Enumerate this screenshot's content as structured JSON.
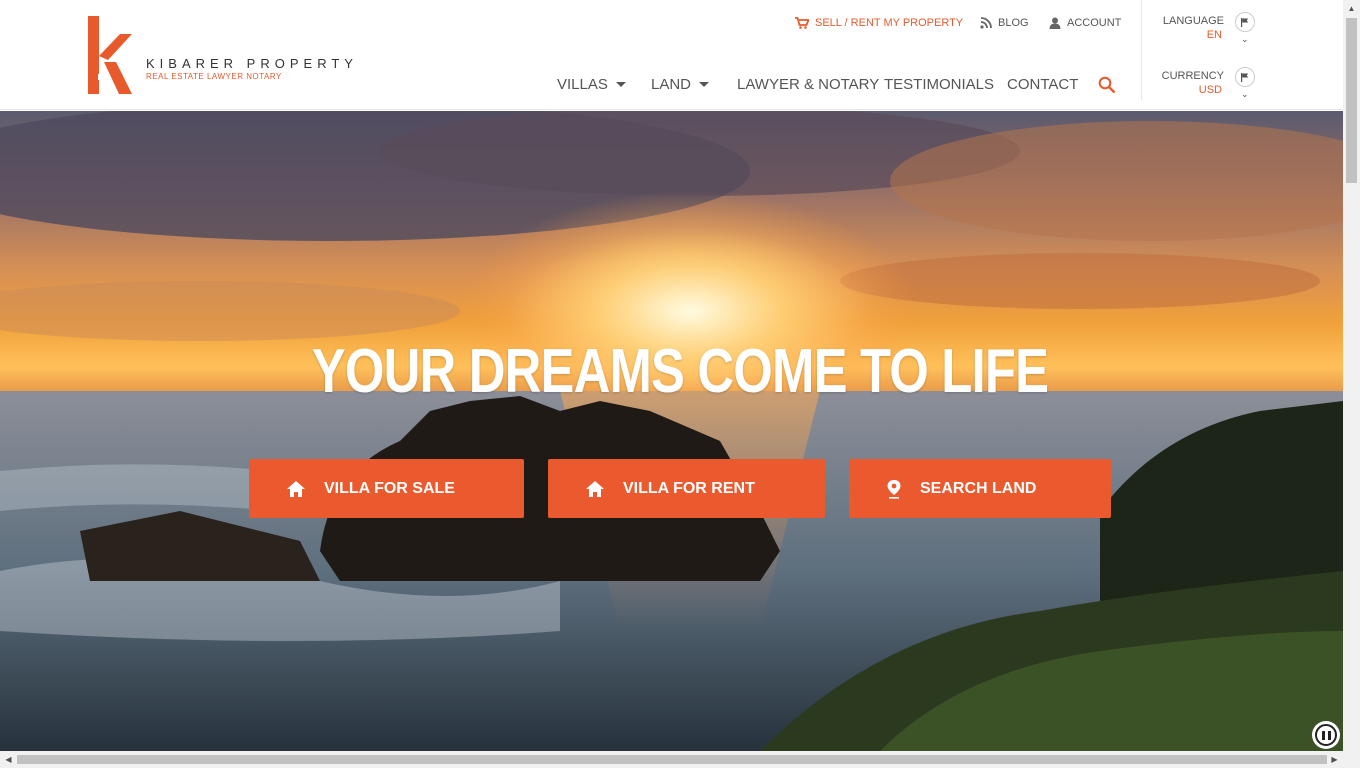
{
  "brand": {
    "name": "KIBARER PROPERTY",
    "tagline": "REAL ESTATE   LAWYER   NOTARY",
    "accent": "#e85a2c"
  },
  "topbar": {
    "sell": "SELL / RENT MY PROPERTY",
    "blog": "BLOG",
    "account": "ACCOUNT"
  },
  "nav": {
    "villas": "VILLAS",
    "land": "LAND",
    "lawyer": "LAWYER & NOTARY",
    "testimonials": "TESTIMONIALS",
    "contact": "CONTACT"
  },
  "selectors": {
    "language_label": "LANGUAGE",
    "language_value": "EN",
    "currency_label": "CURRENCY",
    "currency_value": "USD"
  },
  "hero": {
    "title": "YOUR DREAMS COME TO LIFE",
    "buttons": {
      "villa_sale": "VILLA FOR SALE",
      "villa_rent": "VILLA FOR RENT",
      "search_land": "SEARCH LAND"
    }
  },
  "icons": [
    "cart-icon",
    "rss-icon",
    "user-icon",
    "search-icon",
    "flag-icon",
    "home-icon",
    "map-pin-icon",
    "pause-icon"
  ]
}
